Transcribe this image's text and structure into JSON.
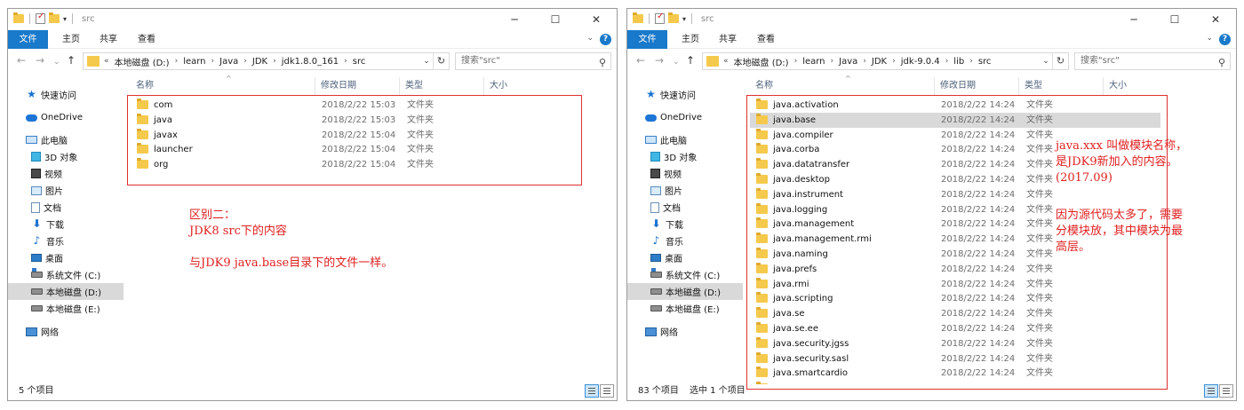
{
  "left": {
    "title": "src",
    "tabs": [
      "文件",
      "主页",
      "共享",
      "查看"
    ],
    "breadcrumb": [
      "本地磁盘 (D:)",
      "learn",
      "Java",
      "JDK",
      "jdk1.8.0_161",
      "src"
    ],
    "search_placeholder": "搜索\"src\"",
    "columns": [
      "名称",
      "修改日期",
      "类型",
      "大小"
    ],
    "files": [
      {
        "name": "com",
        "date": "2018/2/22 15:03",
        "type": "文件夹"
      },
      {
        "name": "java",
        "date": "2018/2/22 15:03",
        "type": "文件夹"
      },
      {
        "name": "javax",
        "date": "2018/2/22 15:04",
        "type": "文件夹"
      },
      {
        "name": "launcher",
        "date": "2018/2/22 15:04",
        "type": "文件夹"
      },
      {
        "name": "org",
        "date": "2018/2/22 15:04",
        "type": "文件夹"
      }
    ],
    "status_count": "5 个项目",
    "annotation": "区别二：\nJDK8 src下的内容\n\n与JDK9 java.base目录下的文件一样。"
  },
  "right": {
    "title": "src",
    "tabs": [
      "文件",
      "主页",
      "共享",
      "查看"
    ],
    "breadcrumb": [
      "本地磁盘 (D:)",
      "learn",
      "Java",
      "JDK",
      "jdk-9.0.4",
      "lib",
      "src"
    ],
    "search_placeholder": "搜索\"src\"",
    "columns": [
      "名称",
      "修改日期",
      "类型",
      "大小"
    ],
    "files": [
      {
        "name": "java.activation",
        "date": "2018/2/22 14:24",
        "type": "文件夹"
      },
      {
        "name": "java.base",
        "date": "2018/2/22 14:24",
        "type": "文件夹"
      },
      {
        "name": "java.compiler",
        "date": "2018/2/22 14:24",
        "type": "文件夹"
      },
      {
        "name": "java.corba",
        "date": "2018/2/22 14:24",
        "type": "文件夹"
      },
      {
        "name": "java.datatransfer",
        "date": "2018/2/22 14:24",
        "type": "文件夹"
      },
      {
        "name": "java.desktop",
        "date": "2018/2/22 14:24",
        "type": "文件夹"
      },
      {
        "name": "java.instrument",
        "date": "2018/2/22 14:24",
        "type": "文件夹"
      },
      {
        "name": "java.logging",
        "date": "2018/2/22 14:24",
        "type": "文件夹"
      },
      {
        "name": "java.management",
        "date": "2018/2/22 14:24",
        "type": "文件夹"
      },
      {
        "name": "java.management.rmi",
        "date": "2018/2/22 14:24",
        "type": "文件夹"
      },
      {
        "name": "java.naming",
        "date": "2018/2/22 14:24",
        "type": "文件夹"
      },
      {
        "name": "java.prefs",
        "date": "2018/2/22 14:24",
        "type": "文件夹"
      },
      {
        "name": "java.rmi",
        "date": "2018/2/22 14:24",
        "type": "文件夹"
      },
      {
        "name": "java.scripting",
        "date": "2018/2/22 14:24",
        "type": "文件夹"
      },
      {
        "name": "java.se",
        "date": "2018/2/22 14:24",
        "type": "文件夹"
      },
      {
        "name": "java.se.ee",
        "date": "2018/2/22 14:24",
        "type": "文件夹"
      },
      {
        "name": "java.security.jgss",
        "date": "2018/2/22 14:24",
        "type": "文件夹"
      },
      {
        "name": "java.security.sasl",
        "date": "2018/2/22 14:24",
        "type": "文件夹"
      },
      {
        "name": "java.smartcardio",
        "date": "2018/2/22 14:24",
        "type": "文件夹"
      }
    ],
    "status_count": "83 个项目",
    "status_selected": "选中 1 个项目",
    "annotation1": "java.xxx 叫做模块名称，\n是JDK9新加入的内容。\n(2017.09)",
    "annotation2": "因为源代码太多了，需要\n分模块放，其中模块为最\n高层。"
  },
  "sidebar": [
    {
      "label": "快速访问",
      "icon": "star-icon"
    },
    {
      "label": "OneDrive",
      "icon": "cloud-icon"
    },
    {
      "label": "此电脑",
      "icon": "pc-icon"
    },
    {
      "label": "3D 对象",
      "icon": "3d-objects-icon"
    },
    {
      "label": "视频",
      "icon": "video-icon"
    },
    {
      "label": "图片",
      "icon": "pictures-icon"
    },
    {
      "label": "文档",
      "icon": "documents-icon"
    },
    {
      "label": "下载",
      "icon": "download-icon"
    },
    {
      "label": "音乐",
      "icon": "music-icon"
    },
    {
      "label": "桌面",
      "icon": "desktop-icon"
    },
    {
      "label": "系统文件 (C:)",
      "icon": "system-drive-icon"
    },
    {
      "label": "本地磁盘 (D:)",
      "icon": "drive-icon"
    },
    {
      "label": "本地磁盘 (E:)",
      "icon": "drive-icon"
    },
    {
      "label": "网络",
      "icon": "network-icon"
    }
  ],
  "colors": {
    "accent": "#1979ca",
    "folder": "#f5c94c",
    "annotation": "#e02020",
    "selected_row": "#d9d9d9"
  }
}
